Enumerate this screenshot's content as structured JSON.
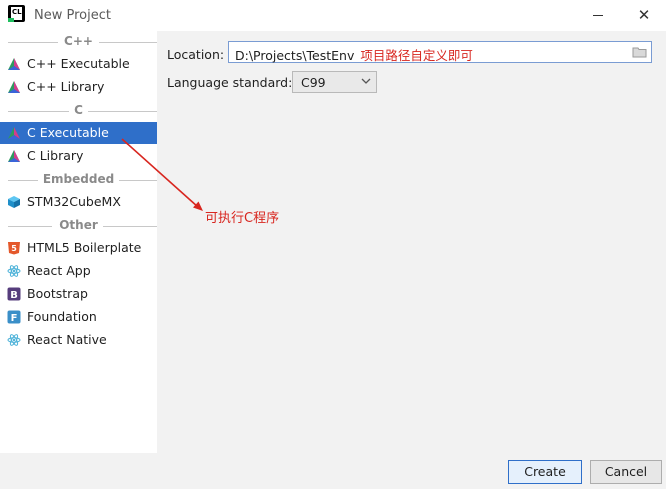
{
  "window": {
    "title": "New Project",
    "minimize_glyph": "—",
    "close_glyph": "✕"
  },
  "sidebar": {
    "groups": [
      {
        "header": "C++",
        "items": [
          {
            "label": "C++ Executable",
            "icon": "clion-triangle-icon"
          },
          {
            "label": "C++ Library",
            "icon": "clion-triangle-icon"
          }
        ]
      },
      {
        "header": "C",
        "items": [
          {
            "label": "C Executable",
            "icon": "clion-triangle-icon",
            "selected": true
          },
          {
            "label": "C Library",
            "icon": "clion-triangle-icon"
          }
        ]
      },
      {
        "header": "Embedded",
        "items": [
          {
            "label": "STM32CubeMX",
            "icon": "cube-icon"
          }
        ]
      },
      {
        "header": "Other",
        "items": [
          {
            "label": "HTML5 Boilerplate",
            "icon": "html5-icon"
          },
          {
            "label": "React App",
            "icon": "react-icon"
          },
          {
            "label": "Bootstrap",
            "icon": "bootstrap-icon"
          },
          {
            "label": "Foundation",
            "icon": "foundation-icon"
          },
          {
            "label": "React Native",
            "icon": "react-icon"
          }
        ]
      }
    ]
  },
  "form": {
    "location_label": "Location:",
    "location_value": "D:\\Projects\\TestEnv",
    "location_note": "项目路径自定义即可",
    "language_label": "Language standard:",
    "language_value": "C99"
  },
  "annotation": {
    "text": "可执行C程序",
    "color": "#d8261f"
  },
  "buttons": {
    "create": "Create",
    "cancel": "Cancel"
  },
  "colors": {
    "selection": "#2f6fc9",
    "annotation_red": "#d8261f"
  }
}
